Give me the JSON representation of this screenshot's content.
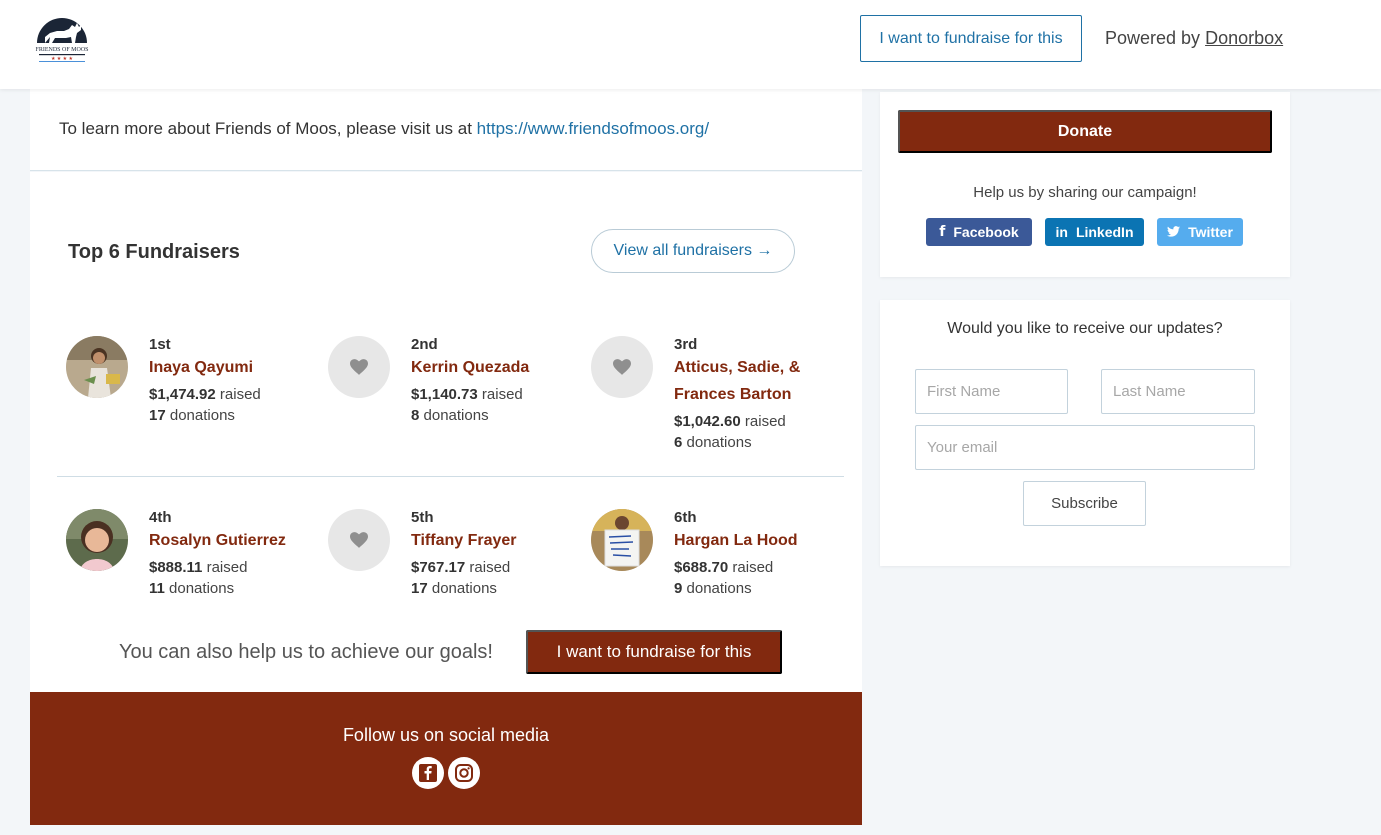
{
  "header": {
    "logo_text": "FRIENDS OF MOOS",
    "fundraise_button": "I want to fundraise for this",
    "powered_prefix": "Powered by",
    "powered_link": "Donorbox"
  },
  "learn_more": {
    "text": "To learn more about Friends of Moos, please visit us at",
    "link": "https://www.friendsofmoos.org/"
  },
  "top_fundraisers": {
    "title": "Top 6 Fundraisers",
    "view_all": "View all fundraisers →",
    "raised_word": "raised",
    "donations_word": "donations",
    "items": [
      {
        "rank": "1st",
        "name": "Inaya Qayumi",
        "amount": "$1,474.92",
        "donations": "17",
        "avatar": "photo-girl"
      },
      {
        "rank": "2nd",
        "name": "Kerrin Quezada",
        "amount": "$1,140.73",
        "donations": "8",
        "avatar": "heart-icon"
      },
      {
        "rank": "3rd",
        "name": "Atticus, Sadie, & Frances Barton",
        "amount": "$1,042.60",
        "donations": "6",
        "avatar": "heart-icon"
      },
      {
        "rank": "4th",
        "name": "Rosalyn Gutierrez",
        "amount": "$888.11",
        "donations": "11",
        "avatar": "photo-toddler"
      },
      {
        "rank": "5th",
        "name": "Tiffany Frayer",
        "amount": "$767.17",
        "donations": "17",
        "avatar": "heart-icon"
      },
      {
        "rank": "6th",
        "name": "Hargan La Hood",
        "amount": "$688.70",
        "donations": "9",
        "avatar": "photo-boy-sign"
      }
    ]
  },
  "cta": {
    "text": "You can also help us to achieve our goals!",
    "button": "I want to fundraise for this"
  },
  "social_footer": {
    "text": "Follow us on social media",
    "icons": [
      "facebook-icon",
      "instagram-icon"
    ]
  },
  "donate_card": {
    "donate_button": "Donate",
    "share_text": "Help us by sharing our campaign!",
    "share_buttons": {
      "facebook": "Facebook",
      "linkedin": "LinkedIn",
      "twitter": "Twitter"
    }
  },
  "updates_card": {
    "question": "Would you like to receive our updates?",
    "first_name_placeholder": "First Name",
    "last_name_placeholder": "Last Name",
    "email_placeholder": "Your email",
    "subscribe_button": "Subscribe"
  },
  "colors": {
    "brand": "#82290f",
    "link": "#1f71a5",
    "background": "#f3f6f9"
  }
}
